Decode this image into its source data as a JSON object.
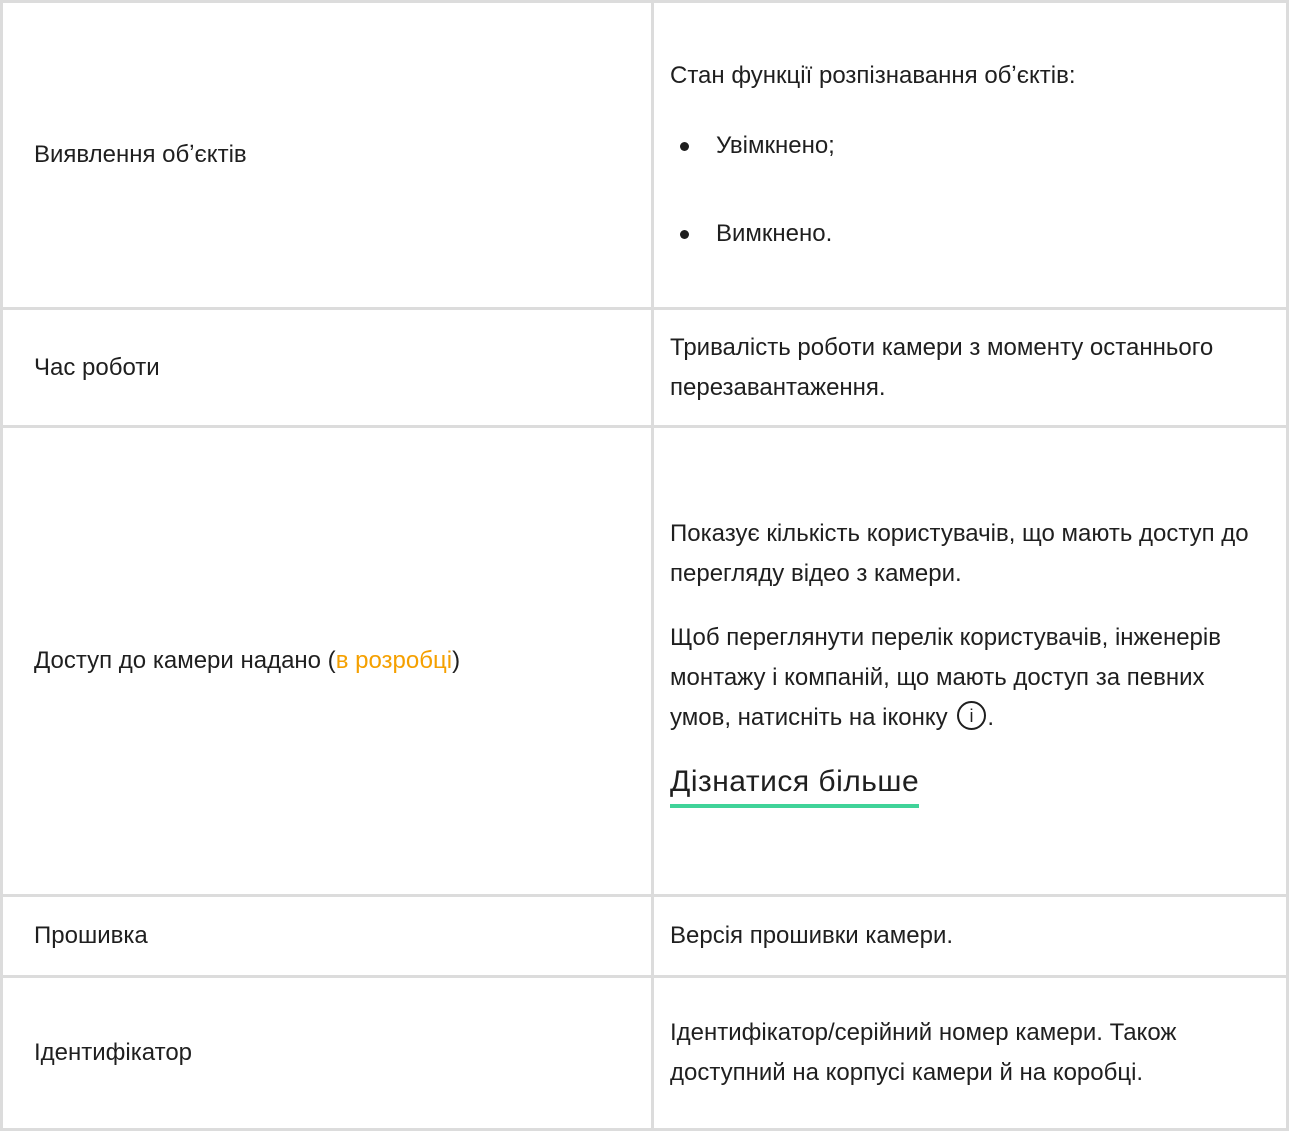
{
  "rows": {
    "object_detection": {
      "name": "Виявлення обʼєктів",
      "description": "Стан функції розпізнавання обʼєктів:",
      "options": [
        "Увімкнено;",
        "Вимкнено."
      ]
    },
    "uptime": {
      "name": "Час роботи",
      "description": "Тривалість роботи камери з моменту останнього перезавантаження."
    },
    "access": {
      "name_prefix": "Доступ до камери надано (",
      "name_link": "в розробці",
      "name_suffix": ")",
      "description_1": "Показує кількість користувачів, що мають доступ до перегляду відео з камери.",
      "description_2": "Щоб переглянути перелік користувачів, інженерів монтажу і компаній, що мають доступ за певних умов, натисніть на іконку",
      "description_2_end": ".",
      "learn_more": "Дізнатися більше",
      "info_icon_glyph": "i"
    },
    "firmware": {
      "name": "Прошивка",
      "description": "Версія прошивки камери."
    },
    "identifier": {
      "name": "Ідентифікатор",
      "description": "Ідентифікатор/серійний номер камери. Також доступний на корпусі камери й на коробці."
    }
  },
  "colors": {
    "link_orange": "#f5a000",
    "underline_green": "#40d399",
    "border": "#dcdcdc",
    "text": "#1f1f1f"
  },
  "icons": {
    "info": "info-circle-icon"
  }
}
